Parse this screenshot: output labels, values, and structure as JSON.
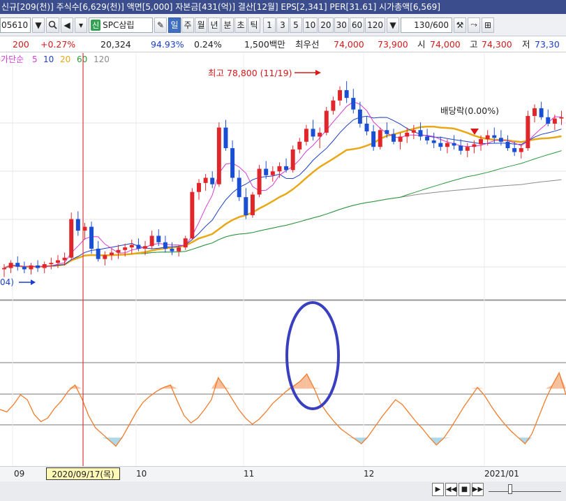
{
  "top_info": "신규[209(천)] 주식수[6,629(천)] 액면[5,000] 자본금[431(억)] 결산[12월] EPS[2,341] PER[31.61] 시가총액[6,569]",
  "toolbar": {
    "code": "05610",
    "badge": "신",
    "stock_name": "SPC삼립",
    "periods": [
      "일",
      "주",
      "월",
      "년",
      "분",
      "초",
      "틱"
    ],
    "active_period": "일",
    "minutes": [
      "1",
      "3",
      "5",
      "10",
      "20",
      "30",
      "60",
      "120"
    ],
    "count": "130",
    "count_total": "/600"
  },
  "quote": {
    "change": "200",
    "change_pct": "+0.27%",
    "volume": "20,324",
    "ratio": "94.93%",
    "turnover": "0.24%",
    "amount": "1,500백만",
    "best_label": "최우선",
    "ask": "74,000",
    "bid": "73,900",
    "open_label": "시",
    "open": "74,000",
    "high_label": "고",
    "high": "74,300",
    "low_label": "저",
    "low": "73,30"
  },
  "colors": {
    "up": "#e0262a",
    "down": "#1b4fd3",
    "ma5": "#d63bd6",
    "ma10": "#1d3fc6",
    "ma20": "#e8a817",
    "ma60": "#2a9a3c",
    "ma120": "#8c8c8c",
    "oscillator": "#f07d2c",
    "ellipse": "#3a3fc0"
  },
  "chart_data": {
    "type": "candlestick",
    "legend": [
      {
        "name": "주가단순",
        "color": "#d63bd6"
      },
      {
        "name": "5",
        "color": "#d63bd6"
      },
      {
        "name": "10",
        "color": "#1d3fc6"
      },
      {
        "name": "20",
        "color": "#e8a817"
      },
      {
        "name": "60",
        "color": "#2a9a3c"
      },
      {
        "name": "120",
        "color": "#8c8c8c"
      }
    ],
    "annotations": {
      "high_label": "최고 78,800 (11/19)",
      "dividend_label": "배당락(0.00%)",
      "left_label": "04)"
    },
    "x_labels": [
      "09",
      "2020/09/17(목)",
      "10",
      "11",
      "12",
      "2021/01"
    ],
    "candles": [
      [
        64200,
        64600,
        63600,
        64300
      ],
      [
        64300,
        64900,
        63900,
        64700
      ],
      [
        64700,
        65200,
        64100,
        64400
      ],
      [
        64400,
        64800,
        63900,
        64200
      ],
      [
        64200,
        64700,
        63800,
        64500
      ],
      [
        64500,
        64900,
        64000,
        64300
      ],
      [
        64300,
        64800,
        63900,
        64600
      ],
      [
        64600,
        65100,
        64200,
        64700
      ],
      [
        64700,
        65300,
        64300,
        64900
      ],
      [
        64900,
        65500,
        64500,
        65100
      ],
      [
        65100,
        68600,
        64900,
        68100
      ],
      [
        68100,
        68700,
        66800,
        67200
      ],
      [
        67200,
        67800,
        66500,
        67500
      ],
      [
        67500,
        67900,
        65400,
        65800
      ],
      [
        65800,
        66400,
        64800,
        65000
      ],
      [
        65000,
        65600,
        64500,
        65300
      ],
      [
        65300,
        65800,
        64900,
        65500
      ],
      [
        65500,
        66100,
        65000,
        65700
      ],
      [
        65700,
        66200,
        65200,
        65900
      ],
      [
        65900,
        66500,
        65400,
        66100
      ],
      [
        66100,
        66600,
        65600,
        65800
      ],
      [
        65800,
        66400,
        65300,
        66000
      ],
      [
        66000,
        67200,
        65800,
        66800
      ],
      [
        66800,
        67300,
        66000,
        66300
      ],
      [
        66300,
        66800,
        65500,
        65800
      ],
      [
        65800,
        66300,
        65300,
        65600
      ],
      [
        65600,
        66100,
        65200,
        65900
      ],
      [
        65900,
        66800,
        65700,
        66600
      ],
      [
        66600,
        70500,
        66500,
        70200
      ],
      [
        70200,
        71200,
        69600,
        70900
      ],
      [
        70900,
        71600,
        70300,
        71300
      ],
      [
        71300,
        71800,
        70500,
        70800
      ],
      [
        70800,
        75600,
        70600,
        75200
      ],
      [
        75200,
        75800,
        73400,
        73600
      ],
      [
        73600,
        74200,
        71000,
        71300
      ],
      [
        71300,
        71900,
        69500,
        69800
      ],
      [
        69800,
        70500,
        68100,
        68400
      ],
      [
        68400,
        70200,
        68200,
        70000
      ],
      [
        70000,
        72300,
        69800,
        72000
      ],
      [
        72000,
        72600,
        71200,
        71500
      ],
      [
        71500,
        72200,
        71000,
        71800
      ],
      [
        71800,
        72500,
        71300,
        72200
      ],
      [
        72200,
        72800,
        71700,
        71900
      ],
      [
        71900,
        73800,
        71700,
        73500
      ],
      [
        73500,
        74400,
        73200,
        74100
      ],
      [
        74100,
        75400,
        73800,
        75100
      ],
      [
        75100,
        75800,
        74200,
        74500
      ],
      [
        74500,
        75200,
        73600,
        74800
      ],
      [
        74800,
        76800,
        74600,
        76500
      ],
      [
        76500,
        77600,
        76200,
        77300
      ],
      [
        77300,
        78400,
        76900,
        78100
      ],
      [
        78100,
        78800,
        77100,
        77500
      ],
      [
        77500,
        78200,
        76300,
        76600
      ],
      [
        76600,
        77200,
        75200,
        75500
      ],
      [
        75500,
        76100,
        74600,
        74900
      ],
      [
        74900,
        75400,
        73400,
        73700
      ],
      [
        73700,
        75200,
        73500,
        75000
      ],
      [
        75000,
        75600,
        74400,
        74700
      ],
      [
        74700,
        75100,
        73900,
        74100
      ],
      [
        74100,
        74800,
        73500,
        74500
      ],
      [
        74500,
        75200,
        74000,
        74800
      ],
      [
        74800,
        75400,
        74300,
        75000
      ],
      [
        75000,
        75600,
        74200,
        74500
      ],
      [
        74500,
        75100,
        73900,
        74200
      ],
      [
        74200,
        74800,
        73600,
        74000
      ],
      [
        74000,
        74500,
        73400,
        73700
      ],
      [
        73700,
        74300,
        73200,
        74000
      ],
      [
        74000,
        74600,
        73500,
        73800
      ],
      [
        73800,
        74300,
        73100,
        73400
      ],
      [
        73400,
        74000,
        72900,
        73700
      ],
      [
        73700,
        74200,
        73200,
        73900
      ],
      [
        73900,
        74600,
        73400,
        74300
      ],
      [
        74300,
        75000,
        73800,
        74600
      ],
      [
        74600,
        75200,
        74000,
        74400
      ],
      [
        74400,
        75000,
        73800,
        74100
      ],
      [
        74100,
        74600,
        73400,
        73600
      ],
      [
        73600,
        74100,
        73000,
        73300
      ],
      [
        73300,
        73900,
        72800,
        73600
      ],
      [
        73600,
        76500,
        73400,
        76100
      ],
      [
        76100,
        77000,
        75600,
        76700
      ],
      [
        76700,
        77200,
        75800,
        76000
      ],
      [
        76000,
        76600,
        75300,
        75500
      ],
      [
        75500,
        76200,
        75000,
        75900
      ],
      [
        75900,
        76500,
        75400,
        76000
      ]
    ],
    "oscillator": [
      40,
      38,
      44,
      52,
      48,
      36,
      30,
      33,
      41,
      47,
      55,
      60,
      49,
      35,
      25,
      20,
      15,
      10,
      18,
      28,
      38,
      46,
      51,
      55,
      58,
      60,
      47,
      35,
      29,
      33,
      40,
      48,
      66,
      58,
      49,
      40,
      33,
      28,
      32,
      38,
      45,
      50,
      55,
      59,
      63,
      69,
      58,
      45,
      37,
      30,
      24,
      20,
      16,
      12,
      18,
      26,
      34,
      41,
      48,
      44,
      37,
      30,
      24,
      17,
      11,
      16,
      24,
      33,
      42,
      50,
      58,
      52,
      43,
      35,
      28,
      22,
      17,
      12,
      20,
      34,
      48,
      60,
      70,
      52
    ]
  }
}
